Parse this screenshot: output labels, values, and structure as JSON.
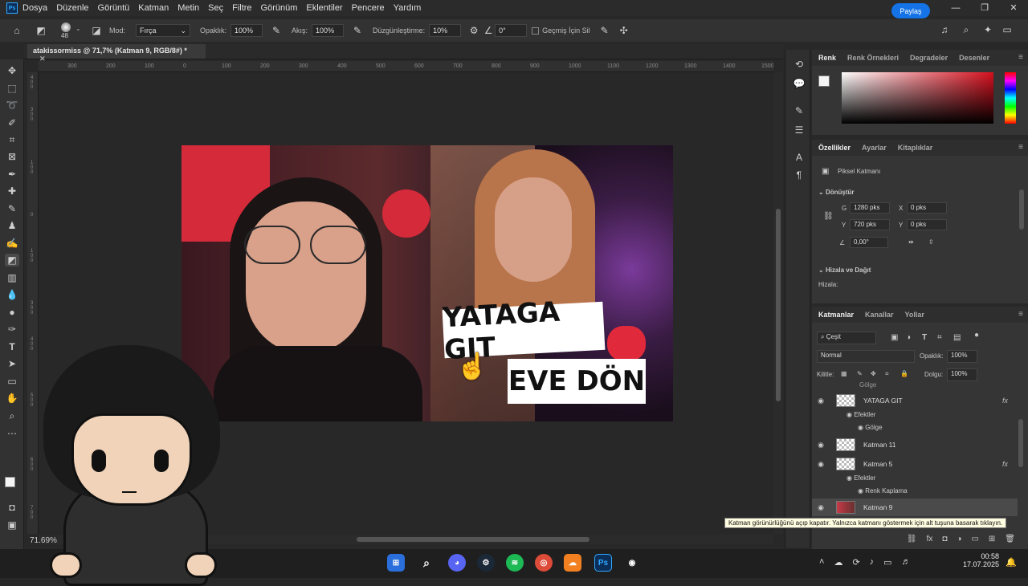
{
  "menu": {
    "items": [
      "Dosya",
      "Düzenle",
      "Görüntü",
      "Katman",
      "Metin",
      "Seç",
      "Filtre",
      "Görünüm",
      "Eklentiler",
      "Pencere",
      "Yardım"
    ]
  },
  "options": {
    "brush_size": "48",
    "mode_label": "Mod:",
    "mode_value": "Fırça",
    "opacity_label": "Opaklık:",
    "opacity_value": "100%",
    "flow_label": "Akış:",
    "flow_value": "100%",
    "smoothing_label": "Düzgünleştirme:",
    "smoothing_value": "10%",
    "angle_value": "0°",
    "history_label": "Geçmiş İçin Sil",
    "share_label": "Paylaş"
  },
  "document": {
    "tab_title": "atakissormiss @ 71,7% (Katman 9, RGB/8#) *",
    "zoom": "71.69%",
    "ruler_ticks": [
      "300",
      "200",
      "100",
      "0",
      "100",
      "200",
      "300",
      "400",
      "500",
      "600",
      "700",
      "800",
      "900",
      "1000",
      "1100",
      "1200",
      "1300",
      "1400",
      "1500"
    ]
  },
  "thumbnail": {
    "line1": "YATAGA GIT",
    "line2": "EVE DÖN"
  },
  "color_panel": {
    "tabs": [
      "Renk",
      "Renk Örnekleri",
      "Degradeler",
      "Desenler"
    ]
  },
  "properties_panel": {
    "tabs": [
      "Özellikler",
      "Ayarlar",
      "Kitaplıklar"
    ],
    "layer_type": "Piksel Katmanı",
    "transform_title": "Dönüştür",
    "w_label": "G",
    "w_value": "1280 pks",
    "x_label": "X",
    "x_value": "0 pks",
    "h_label": "Y",
    "h_value": "720 pks",
    "y_label": "Y",
    "y_value": "0 pks",
    "angle_value": "0,00°",
    "align_title": "Hizala ve Dağıt",
    "align_label": "Hizala:"
  },
  "layers_panel": {
    "tabs": [
      "Katmanlar",
      "Kanallar",
      "Yollar"
    ],
    "filter_label": "Çeşit",
    "blend_mode": "Normal",
    "opacity_label": "Opaklık:",
    "opacity_value": "100%",
    "lock_label": "Kilitle:",
    "fill_label": "Dolgu:",
    "fill_value": "100%",
    "clipped_text": "Gölge",
    "layers": [
      {
        "name": "YATAGA GIT",
        "fx": "fx",
        "effects_label": "Efektler",
        "effect": "Gölge"
      },
      {
        "name": "Katman 11"
      },
      {
        "name": "Katman 5",
        "fx": "fx",
        "effects_label": "Efektler",
        "effect": "Renk Kaplama"
      },
      {
        "name": "Katman 9"
      }
    ],
    "tooltip": "Katman görünürlüğünü açıp kapatır. Yalnızca katmanı göstermek için alt tuşuna basarak tıklayın."
  },
  "taskbar": {
    "time": "00:58",
    "date": "17.07.2025"
  },
  "colors": {
    "accent": "#1473e6",
    "ps_blue": "#31a8ff",
    "panel_bg": "#353535"
  }
}
